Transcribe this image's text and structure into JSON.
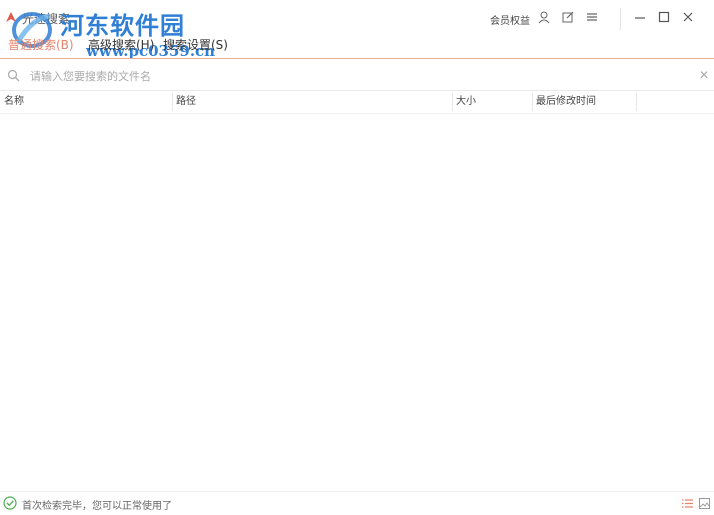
{
  "app": {
    "title": "光速搜索",
    "watermark_text": "河东软件园",
    "watermark_url": "www.pc0359.cn"
  },
  "titlebar": {
    "member_label": "会员权益",
    "icons": [
      "user-icon",
      "edit-icon",
      "menu-icon",
      "minimize-icon",
      "maximize-icon",
      "close-icon"
    ]
  },
  "menu": {
    "items": [
      {
        "label": "普通搜索(B)",
        "active": true
      },
      {
        "label": "高级搜索(H)",
        "active": false
      },
      {
        "label": "搜索设置(S)",
        "active": false
      }
    ]
  },
  "search": {
    "placeholder": "请输入您要搜索的文件名",
    "value": ""
  },
  "table": {
    "columns": [
      "名称",
      "路径",
      "大小",
      "最后修改时间"
    ],
    "rows": []
  },
  "status": {
    "text": "首次检索完毕，您可以正常使用了"
  },
  "colors": {
    "accent": "#e8836a",
    "watermark": "#2f7fd6",
    "status_ok": "#4caf50",
    "list_view_active": "#e8836a"
  }
}
